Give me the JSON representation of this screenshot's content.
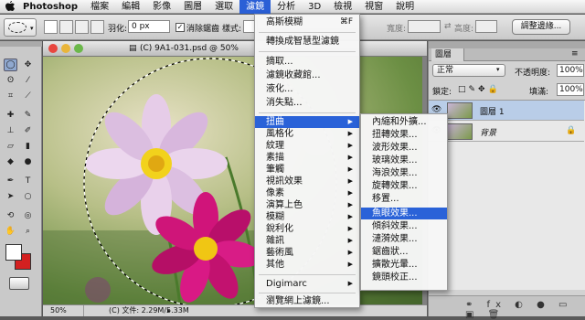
{
  "menubar": {
    "apple": "",
    "app": "Photoshop",
    "items": [
      "檔案",
      "編輯",
      "影像",
      "圖層",
      "選取",
      "濾鏡",
      "分析",
      "3D",
      "檢視",
      "視窗",
      "說明"
    ]
  },
  "optbar": {
    "feather_label": "羽化:",
    "feather_value": "0 px",
    "antialias_label": "消除鋸齒",
    "style_label": "樣式:",
    "width_label": "寬度:",
    "height_label": "高度:",
    "refine_edge_button": "調整邊緣..."
  },
  "document": {
    "title": "(C) 9A1-031.psd @ 50%",
    "zoom": "50%",
    "file_info": "(C) 文件: 2.29M/5.33M"
  },
  "filter_menu": {
    "items": [
      "高斯模糊",
      "轉換成智慧型濾鏡",
      "摘取...",
      "濾鏡收藏館...",
      "液化...",
      "消失點...",
      "扭曲",
      "風格化",
      "紋理",
      "素描",
      "筆觸",
      "視訊效果",
      "像素",
      "演算上色",
      "模糊",
      "銳利化",
      "雜訊",
      "藝術風",
      "其他",
      "Digimarc",
      "瀏覽網上濾鏡..."
    ],
    "shortcut": "⌘F"
  },
  "distort_submenu": {
    "items": [
      "內縮和外擴...",
      "扭轉效果...",
      "波形效果...",
      "玻璃效果...",
      "海浪效果...",
      "旋轉效果...",
      "移置...",
      "魚眼效果...",
      "傾斜效果...",
      "漣漪效果...",
      "鋸齒狀...",
      "擴散光暈...",
      "鏡頭校正..."
    ]
  },
  "layers_panel": {
    "tab": "圖層",
    "blend_mode": "正常",
    "opacity_label": "不透明度:",
    "opacity_value": "100%",
    "lock_label": "鎖定:",
    "fill_label": "填滿:",
    "fill_value": "100%",
    "layers": [
      "圖層 1",
      "背景"
    ]
  },
  "colors": {
    "accent": "#2a62d8",
    "foreground": "#ffffff",
    "background": "#d42020"
  }
}
